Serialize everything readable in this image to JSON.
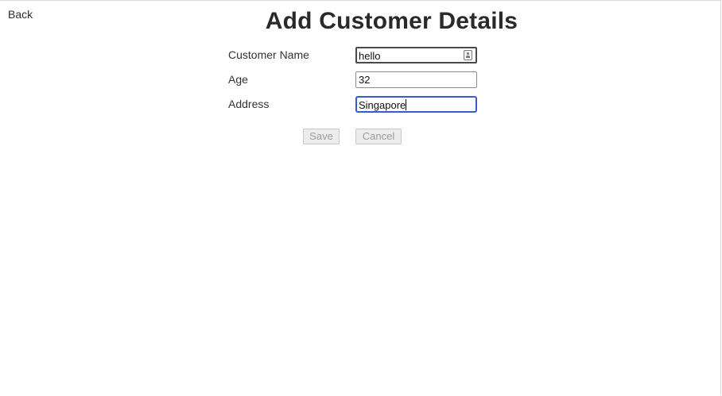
{
  "nav": {
    "back_label": "Back"
  },
  "page": {
    "title": "Add Customer Details"
  },
  "form": {
    "customer_name": {
      "label": "Customer Name",
      "value": "hello"
    },
    "age": {
      "label": "Age",
      "value": "32"
    },
    "address": {
      "label": "Address",
      "value": "Singapore"
    }
  },
  "actions": {
    "save_label": "Save",
    "cancel_label": "Cancel"
  },
  "icons": {
    "autofill": "contact-card-icon"
  },
  "colors": {
    "focus_border": "#2f5fd0",
    "disabled_text": "#9c9c9c"
  }
}
